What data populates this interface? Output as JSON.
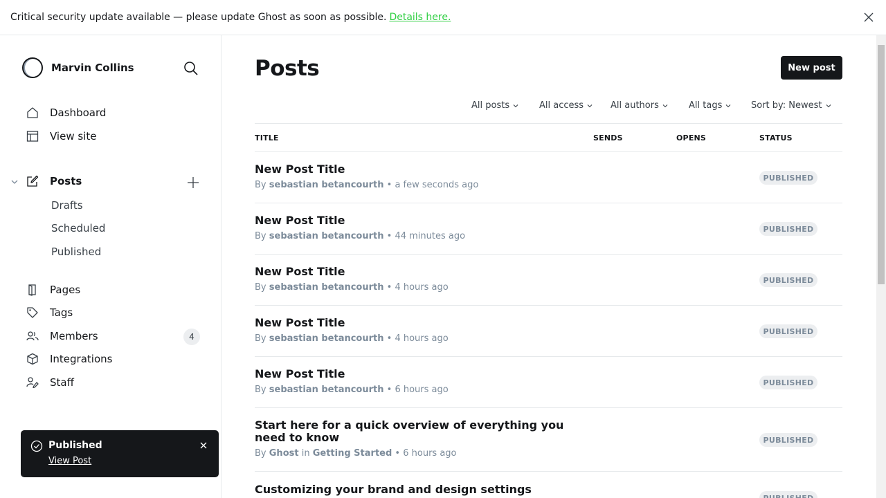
{
  "banner": {
    "message": "Critical security update available — please update Ghost as soon as possible.",
    "link": "Details here."
  },
  "sidebar": {
    "site_name": "Marvin Collins",
    "nav": {
      "dashboard": "Dashboard",
      "view_site": "View site",
      "posts": "Posts",
      "drafts": "Drafts",
      "scheduled": "Scheduled",
      "published": "Published",
      "pages": "Pages",
      "tags": "Tags",
      "members": "Members",
      "members_count": "4",
      "integrations": "Integrations",
      "staff": "Staff"
    }
  },
  "toast": {
    "title": "Published",
    "link": "View Post"
  },
  "main": {
    "title": "Posts",
    "new_post": "New post",
    "filters": {
      "type": "All posts",
      "access": "All access",
      "authors": "All authors",
      "tags": "All tags",
      "sort": "Sort by: Newest"
    },
    "columns": {
      "title": "TITLE",
      "sends": "SENDS",
      "opens": "OPENS",
      "status": "STATUS"
    },
    "posts": [
      {
        "title": "New Post Title",
        "by": "By",
        "author": "sebastian betancourth",
        "sep": "•",
        "time": "a few seconds ago",
        "status": "PUBLISHED"
      },
      {
        "title": "New Post Title",
        "by": "By",
        "author": "sebastian betancourth",
        "sep": "•",
        "time": "44 minutes ago",
        "status": "PUBLISHED"
      },
      {
        "title": "New Post Title",
        "by": "By",
        "author": "sebastian betancourth",
        "sep": "•",
        "time": "4 hours ago",
        "status": "PUBLISHED"
      },
      {
        "title": "New Post Title",
        "by": "By",
        "author": "sebastian betancourth",
        "sep": "•",
        "time": "4 hours ago",
        "status": "PUBLISHED"
      },
      {
        "title": "New Post Title",
        "by": "By",
        "author": "sebastian betancourth",
        "sep": "•",
        "time": "6 hours ago",
        "status": "PUBLISHED"
      },
      {
        "title": "Start here for a quick overview of everything you need to know",
        "by": "By",
        "author": "Ghost",
        "in": "in",
        "tag": "Getting Started",
        "sep": "•",
        "time": "6 hours ago",
        "status": "PUBLISHED"
      },
      {
        "title": "Customizing your brand and design settings",
        "status": "PUBLISHED"
      }
    ]
  },
  "colors": {
    "accent_link": "#30cf43",
    "primary_button": "#15171a",
    "badge_bg": "#eceef0",
    "muted_text": "#7c8b9a"
  }
}
